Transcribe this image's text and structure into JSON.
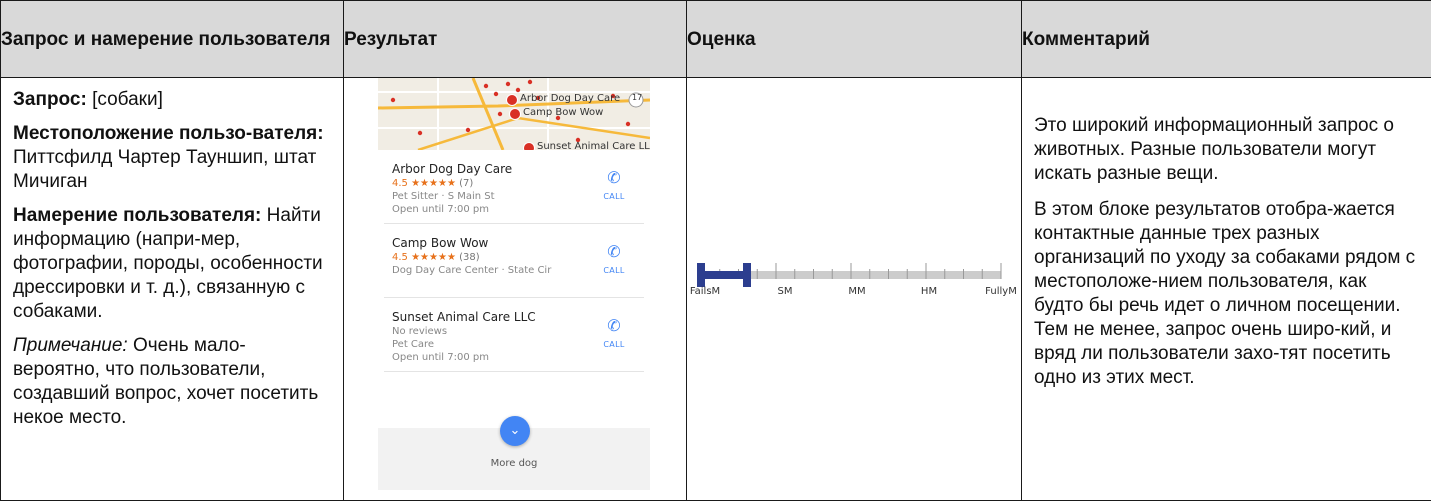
{
  "headers": [
    "Запрос и намерение пользователя",
    "Результат",
    "Оценка",
    "Комментарий"
  ],
  "query": {
    "query_label": "Запрос:",
    "query_value": "[собаки]",
    "location_label": "Местоположение пользо-вателя:",
    "location_value": "Питтсфилд Чартер Тауншип, штат Мичиган",
    "intent_label": "Намерение пользователя:",
    "intent_value": "Найти информацию (напри-мер, фотографии, породы, особенности дрессировки и т. д.), связанную с собаками.",
    "note_label": "Примечание:",
    "note_value": "Очень мало-вероятно, что пользователи, создавший вопрос, хочет посетить некое место."
  },
  "result": {
    "map_labels": [
      "Arbor Dog Day Care",
      "Camp Bow Wow",
      "Sunset Animal Care LLC",
      "17"
    ],
    "listings": [
      {
        "name": "Arbor Dog Day Care",
        "rating": "4.5",
        "stars": "★★★★★",
        "count": "(7)",
        "line1": "Pet Sitter · S Main St",
        "line2": "Open until 7:00 pm",
        "call": "CALL"
      },
      {
        "name": "Camp Bow Wow",
        "rating": "4.5",
        "stars": "★★★★★",
        "count": "(38)",
        "line1": "Dog Day Care Center · State Cir",
        "line2": "",
        "call": "CALL"
      },
      {
        "name": "Sunset Animal Care LLC",
        "rating": "",
        "stars": "",
        "count": "No reviews",
        "line1": "Pet Care",
        "line2": "Open until 7:00 pm",
        "call": "CALL"
      }
    ],
    "more_label": "More dog",
    "colors": {
      "pin": "#d93025",
      "accent": "#4285f4",
      "stars": "#e7711b"
    }
  },
  "rating": {
    "labels": [
      "FailsM",
      "SM",
      "MM",
      "HM",
      "FullyM"
    ],
    "value": "FailsM",
    "value_fraction": 0.1,
    "colors": {
      "marker": "#2c3e8f",
      "track": "#cccccc"
    }
  },
  "comment": {
    "p1": "Это широкий информационный запрос о животных. Разные пользователи могут искать разные вещи.",
    "p2": "В этом блоке результатов отобра-жается контактные данные трех разных организаций по уходу за собаками рядом с местоположе-нием пользователя, как будто бы речь идет о личном посещении. Тем не менее, запрос очень широ-кий, и вряд ли пользователи захо-тят посетить одно из этих мест."
  }
}
